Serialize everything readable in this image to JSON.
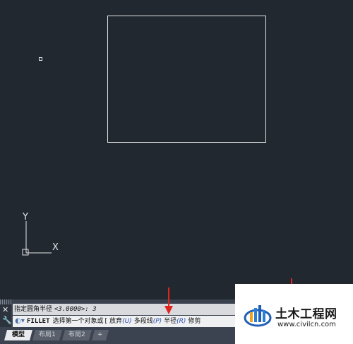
{
  "canvas": {
    "background": "#212830",
    "faint_text": "",
    "ucs": {
      "y_label": "Y",
      "x_label": "X"
    }
  },
  "command": {
    "history_prefix": "指定圆角半径",
    "history_value": "<3.0000>: 3",
    "command_name": "FILLET",
    "prompt": "选择第一个对象或",
    "bracket": "[",
    "options": [
      {
        "label": "放弃",
        "key": "(U)"
      },
      {
        "label": "多段线",
        "key": "(P)"
      },
      {
        "label": "半径",
        "key": "(R)"
      },
      {
        "label": "修剪",
        "key": ""
      }
    ]
  },
  "tabs": [
    {
      "label": "模型",
      "active": true
    },
    {
      "label": "布局1",
      "active": false
    },
    {
      "label": "布局2",
      "active": false
    },
    {
      "label": "+",
      "active": false
    }
  ],
  "watermark": {
    "title": "土木工程网",
    "url": "www.civilcn.com"
  },
  "colors": {
    "annotation_arrow": "#e0261c",
    "prompt_option_key": "#2a4fb0"
  }
}
